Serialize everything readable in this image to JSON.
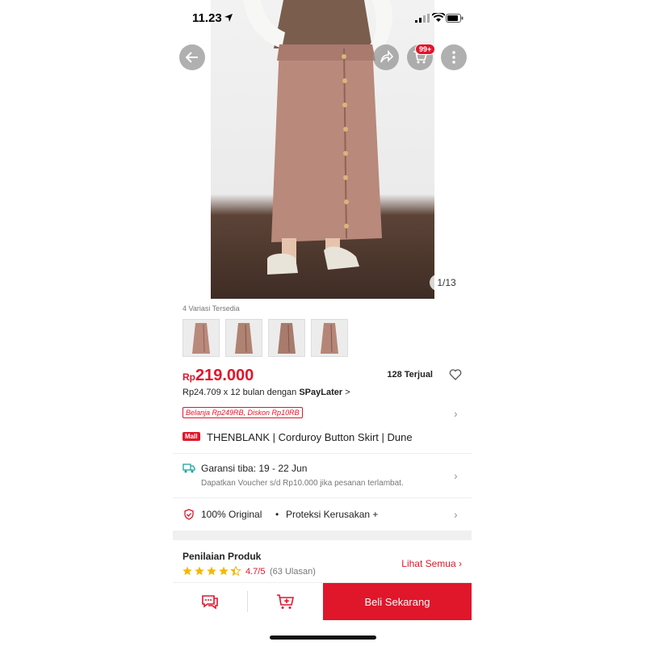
{
  "status_bar": {
    "time": "11.23"
  },
  "gallery": {
    "counter": "1/13",
    "cart_badge": "99+"
  },
  "variants": {
    "label": "4 Variasi Tersedia",
    "count": 4
  },
  "price": {
    "currency": "Rp",
    "amount": "219.000",
    "sold": "128 Terjual"
  },
  "installment": {
    "text": "Rp24.709 x 12 bulan dengan ",
    "brand": "SPayLater",
    "arrow": ">"
  },
  "promo": {
    "label": "Belanja Rp249RB, Diskon Rp10RB"
  },
  "product": {
    "mall_badge": "Mall",
    "title": "THENBLANK | Corduroy Button Skirt | Dune"
  },
  "shipping": {
    "title": "Garansi tiba: 19 - 22 Jun",
    "subtitle": "Dapatkan Voucher s/d Rp10.000 jika pesanan terlambat."
  },
  "guarantee": {
    "original": "100% Original",
    "dot": "•",
    "protection": "Proteksi Kerusakan +"
  },
  "reviews": {
    "title": "Penilaian Produk",
    "rating": "4.7/5",
    "count": "(63 Ulasan)",
    "see_all": "Lihat Semua",
    "stars_value": 4.7
  },
  "bottom_bar": {
    "buy_now": "Beli Sekarang"
  },
  "colors": {
    "accent": "#e0162b",
    "skirt": "#b9897b"
  }
}
